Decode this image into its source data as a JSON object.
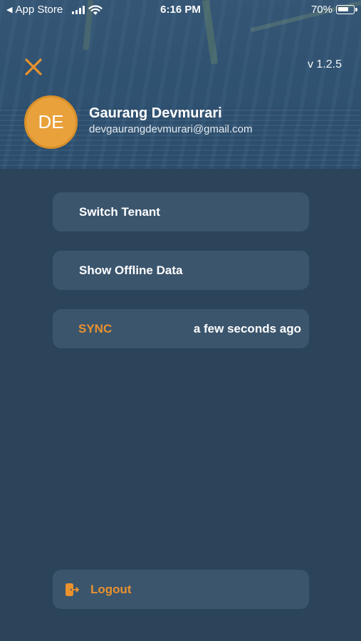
{
  "status_bar": {
    "back_label": "App Store",
    "time": "6:16 PM",
    "battery_percent": "70%",
    "battery_level": 0.7
  },
  "header": {
    "version": "v 1.2.5",
    "avatar_initials": "DE",
    "user_name": "Gaurang Devmurari",
    "user_email": "devgaurangdevmurari@gmail.com"
  },
  "menu": {
    "switch_tenant": "Switch Tenant",
    "show_offline_data": "Show Offline Data",
    "sync_label": "SYNC",
    "sync_time": "a few seconds ago",
    "logout": "Logout"
  },
  "colors": {
    "background": "#2c4459",
    "card": "#3b556d",
    "accent": "#e9922e",
    "avatar": "#e9a13b"
  },
  "icons": {
    "close": "close-icon",
    "logout": "logout-icon",
    "back": "back-triangle-icon",
    "signal": "signal-icon",
    "wifi": "wifi-icon",
    "battery": "battery-icon"
  }
}
